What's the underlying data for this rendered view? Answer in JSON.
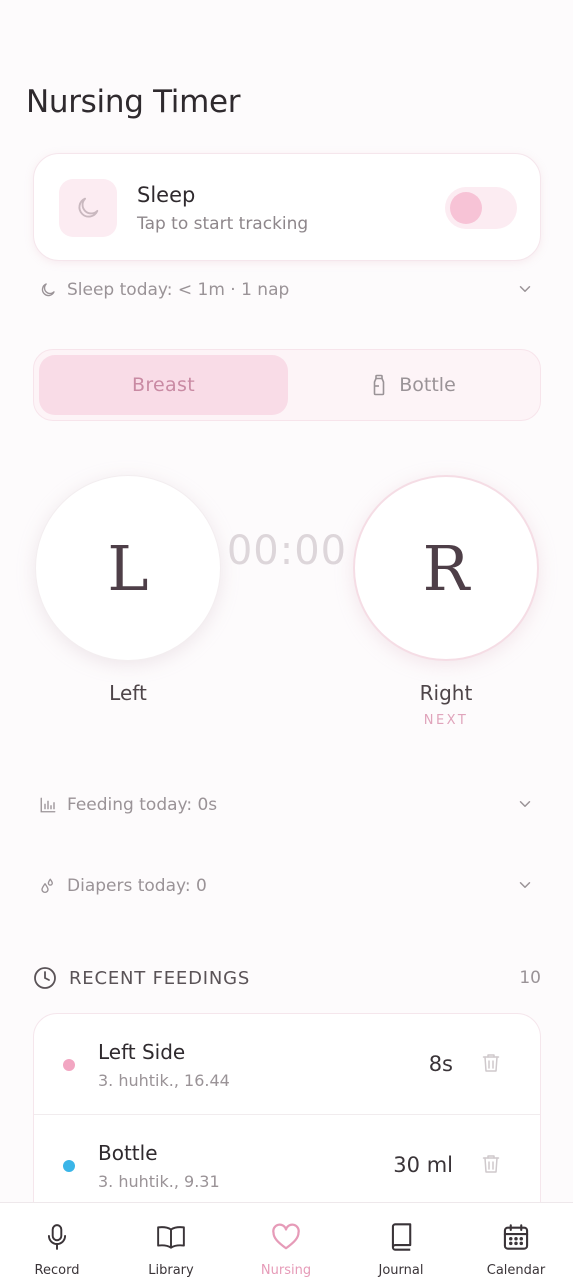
{
  "page": {
    "title": "Nursing Timer"
  },
  "sleep": {
    "title": "Sleep",
    "subtitle": "Tap to start tracking",
    "icon": "moon-icon",
    "toggle_on": false,
    "summary": "Sleep today: < 1m · 1 nap"
  },
  "feed_type": {
    "tabs": [
      {
        "label": "Breast",
        "active": true
      },
      {
        "label": "Bottle",
        "active": false,
        "icon": "bottle-icon"
      }
    ]
  },
  "timer": {
    "display": "00:00",
    "left": {
      "letter": "L",
      "label": "Left"
    },
    "right": {
      "letter": "R",
      "label": "Right",
      "badge": "NEXT"
    }
  },
  "summaries": {
    "feeding": "Feeding today: 0s",
    "diapers": "Diapers today: 0"
  },
  "recent": {
    "title": "RECENT FEEDINGS",
    "count": "10",
    "items": [
      {
        "name": "Left Side",
        "date": "3. huhtik., 16.44",
        "value": "8s",
        "dot_color": "#f2a6c2"
      },
      {
        "name": "Bottle",
        "date": "3. huhtik., 9.31",
        "value": "30 ml",
        "dot_color": "#3ab5e8"
      }
    ]
  },
  "nav": {
    "items": [
      {
        "label": "Record",
        "icon": "microphone-icon",
        "active": false
      },
      {
        "label": "Library",
        "icon": "book-open-icon",
        "active": false
      },
      {
        "label": "Nursing",
        "icon": "heart-icon",
        "active": true
      },
      {
        "label": "Journal",
        "icon": "journal-icon",
        "active": false
      },
      {
        "label": "Calendar",
        "icon": "calendar-icon",
        "active": false
      }
    ]
  },
  "colors": {
    "accent": "#e69bb8",
    "accent_soft": "#f9dce7",
    "background": "#fdfbfc"
  }
}
